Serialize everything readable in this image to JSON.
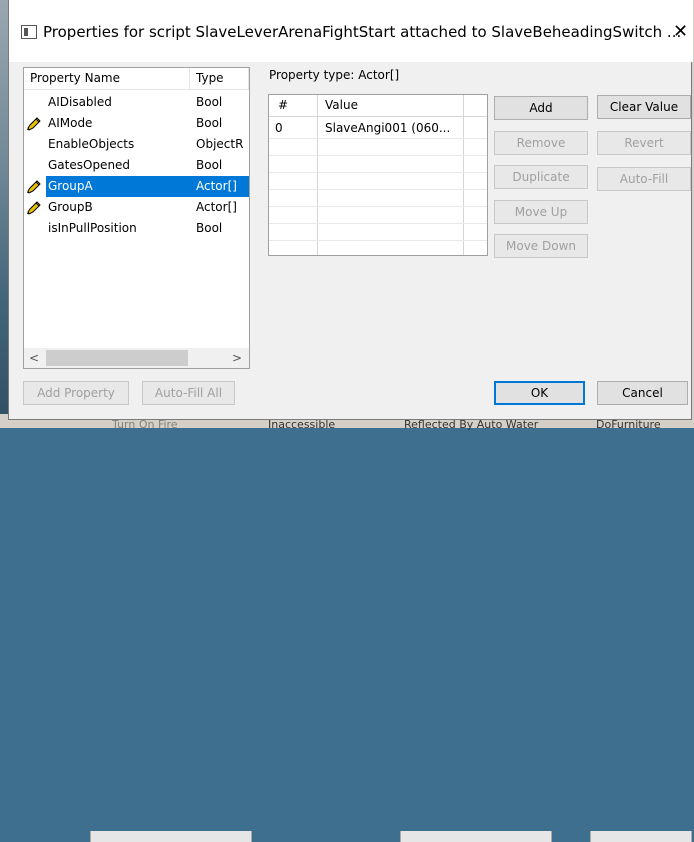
{
  "window": {
    "title": "Properties for script SlaveLeverArenaFightStart attached to SlaveBeheadingSwitch ...",
    "close_glyph": "✕"
  },
  "property_list": {
    "headers": {
      "name": "Property Name",
      "type": "Type"
    },
    "rows": [
      {
        "name": "AIDisabled",
        "type": "Bool",
        "edited": false,
        "selected": false
      },
      {
        "name": "AIMode",
        "type": "Bool",
        "edited": true,
        "selected": false
      },
      {
        "name": "EnableObjects",
        "type": "ObjectR",
        "edited": false,
        "selected": false
      },
      {
        "name": "GatesOpened",
        "type": "Bool",
        "edited": false,
        "selected": false
      },
      {
        "name": "GroupA",
        "type": "Actor[]",
        "edited": true,
        "selected": true
      },
      {
        "name": "GroupB",
        "type": "Actor[]",
        "edited": true,
        "selected": false
      },
      {
        "name": "isInPullPosition",
        "type": "Bool",
        "edited": false,
        "selected": false
      }
    ],
    "scroll_left_glyph": "<",
    "scroll_right_glyph": ">"
  },
  "property_type_label": "Property type: Actor[]",
  "array_table": {
    "headers": {
      "index": "#",
      "value": "Value"
    },
    "rows": [
      {
        "index": "0",
        "value": "SlaveAngi001 (060..."
      }
    ]
  },
  "buttons": {
    "add": "Add",
    "remove": "Remove",
    "duplicate": "Duplicate",
    "move_up": "Move Up",
    "move_down": "Move Down",
    "clear_value": "Clear Value",
    "revert": "Revert",
    "auto_fill": "Auto-Fill",
    "add_property": "Add Property",
    "auto_fill_all": "Auto-Fill All",
    "ok": "OK",
    "cancel": "Cancel"
  },
  "background_fragments": [
    "Turn On Fire",
    "Inaccessible",
    "Reflected By Auto Water",
    "DoFurniture"
  ],
  "colors": {
    "selection": "#0078d7",
    "edited_icon": "#d4a600"
  }
}
